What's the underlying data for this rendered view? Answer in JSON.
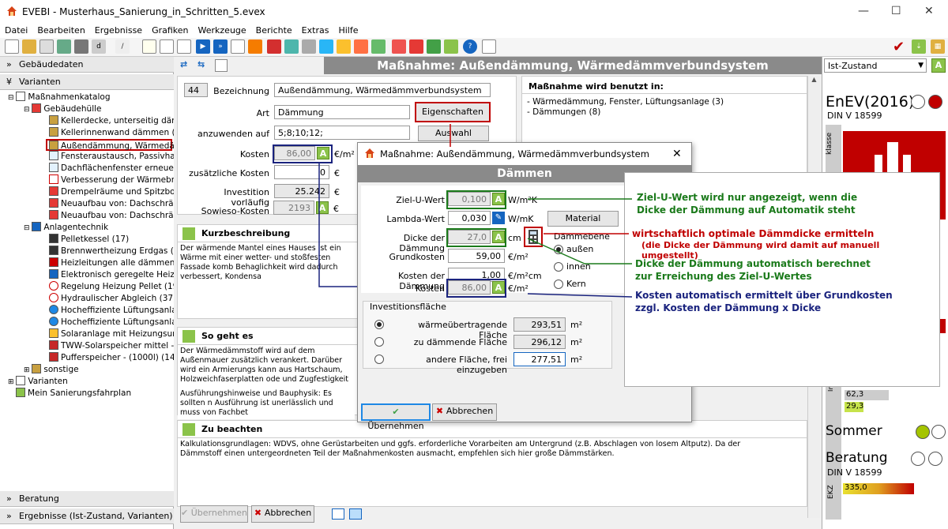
{
  "window": {
    "title": "EVEBI - Musterhaus_Sanierung_in_Schritten_5.evex"
  },
  "menu": [
    "Datei",
    "Bearbeiten",
    "Ergebnisse",
    "Grafiken",
    "Werkzeuge",
    "Berichte",
    "Extras",
    "Hilfe"
  ],
  "left": {
    "sections": {
      "gebaeudedaten": "Gebäudedaten",
      "varianten": "Varianten",
      "beratung": "Beratung",
      "ergebnisse": "Ergebnisse (Ist-Zustand, Varianten)"
    },
    "tree": {
      "root": "Maßnahmenkatalog",
      "gebaeudehuelle": "Gebäudehülle",
      "huelle_items": [
        "Kellerdecke, unterseitig dämme",
        "Kellerinnenwand dämmen (7)",
        "Außendämmung, Wärmedämm",
        "Fensteraustausch, Passivhaus",
        "Dachflächenfenster erneuern",
        "Verbesserung der Wärmebrück",
        "Drempelräume und Spitzboden",
        "Neuaufbau von: Dachschräge",
        "Neuaufbau von: Dachschräge"
      ],
      "anlagentechnik": "Anlagentechnik",
      "anlagen_items": [
        "Pelletkessel (17)",
        "Brennwertheizung Erdgas (41)",
        "Heizleitungen alle dämmen (11",
        "Elektronisch geregelte Heizung",
        "Regelung Heizung Pellet (19)",
        "Hydraulischer Abgleich (37)",
        "Hocheffiziente Lüftungsanlage",
        "Hocheffiziente Lüftungsanlage",
        "Solaranlage mit Heizungsunters",
        "TWW-Solarspeicher mittel - (50",
        "Pufferspeicher - (1000l) (14)"
      ],
      "sonstige": "sonstige",
      "varianten": "Varianten",
      "fahrplan": "Mein Sanierungsfahrplan"
    }
  },
  "main": {
    "title": "Maßnahme: Außendämmung, Wärmedämmverbundsystem",
    "form": {
      "id": "44",
      "bezeichnung_label": "Bezeichnung",
      "bezeichnung": "Außendämmung, Wärmedämmverbundsystem",
      "art_label": "Art",
      "art": "Dämmung",
      "anwenden_label": "anzuwenden auf",
      "anwenden": "5;8;10;12;",
      "kosten_label": "Kosten",
      "kosten": "86,00",
      "kosten_unit": "€/m²",
      "zusatz_label": "zusätzliche Kosten",
      "zusatz": "0",
      "zusatz_unit": "€",
      "invest_label": "Investition vorläufig",
      "invest": "25.242",
      "invest_unit": "€",
      "sowieso_label": "Sowieso-Kosten",
      "sowieso": "2193",
      "sowieso_unit": "€",
      "eigenschaften": "Eigenschaften",
      "auswahl": "Auswahl"
    },
    "used": {
      "title": "Maßnahme wird benutzt in:",
      "items": [
        "- Wärmedämmung, Fenster, Lüftungsanlage (3)",
        "- Dämmungen (8)"
      ]
    },
    "kurz": {
      "title": "Kurzbeschreibung",
      "text": "Der wärmende Mantel eines Hauses ist ein Wärme mit einer wetter- und stoßfesten Fassade komb Behaglichkeit wird dadurch verbessert, Kondensa"
    },
    "sogehts": {
      "title": "So geht es",
      "text": "Der Wärmedämmstoff wird auf dem Außenmauer zusätzlich verankert. Darüber wird ein Armierungs kann aus Hartschaum, Holzweichfaserplatten ode und Zugfestigkeit sowie dem Brandverhalten genü",
      "text2": "Ausführungshinweise und Bauphysik: Es sollten n Ausführung ist unerlässlich und muss von Fachbet"
    },
    "beachten": {
      "title": "Zu beachten",
      "text": "Kalkulationsgrundlagen: WDVS, ohne Gerüstarbeiten und ggfs. erforderliche Vorarbeiten am Untergrund (z.B. Abschlagen von losem Altputz). Da der Dämmstoff einen untergeordneten Teil der Maßnahmenkosten ausmacht, empfehlen sich hier große Dämmstärken."
    },
    "footer": {
      "uebernehmen": "Übernehmen",
      "abbrechen": "Abbrechen"
    }
  },
  "dialog": {
    "title": "Maßnahme: Außendämmung, Wärmedämmverbundsystem",
    "head": "Dämmen",
    "ziel_label": "Ziel-U-Wert",
    "ziel": "0,100",
    "ziel_unit": "W/m²K",
    "lambda_label": "Lambda-Wert",
    "lambda": "0,030",
    "lambda_unit": "W/mK",
    "material": "Material",
    "dicke_label": "Dicke der Dämmung",
    "dicke": "27,0",
    "dicke_unit": "cm",
    "grund_label": "Grundkosten",
    "grund": "59,00",
    "grund_unit": "€/m²",
    "kd_label": "Kosten der Dämmung",
    "kd": "1,00",
    "kd_unit": "€/m²cm",
    "kosten_label": "Kosten",
    "kosten": "86,00",
    "kosten_unit": "€/m²",
    "ebene": {
      "title": "Dämmebene",
      "opts": [
        "außen",
        "innen",
        "Kern"
      ],
      "selected": 0
    },
    "invest": {
      "title": "Investitionsfläche",
      "rows": [
        {
          "label": "wärmeübertragende Fläche",
          "val": "293,51",
          "unit": "m²"
        },
        {
          "label": "zu dämmende Fläche",
          "val": "296,12",
          "unit": "m²"
        },
        {
          "label": "andere Fläche, frei einzugeben",
          "val": "277,51",
          "unit": "m²"
        }
      ],
      "selected": 0
    },
    "ok": "Übernehmen",
    "cancel": "Abbrechen"
  },
  "annotations": {
    "a1": "Ziel-U-Wert wird nur angezeigt, wenn die Dicke der Dämmung auf Automatik steht",
    "a2": "wirtschaftlich optimale Dämmdicke ermitteln",
    "a2b": "(die Dicke der Dämmung wird damit auf manuell umgestellt)",
    "a3": "Dicke der Dämmung automatisch berechnet zur Erreichung des Ziel-U-Wertes",
    "a4": "Kosten automatisch ermittelt über Grundkosten zzgl. Kosten der Dämmung x Dicke"
  },
  "right": {
    "zustand": "Ist-Zustand",
    "enev": "EnEV(2016)",
    "din1": "DIN V 18599",
    "klasse": "klasse",
    "v1": "62,3",
    "v2": "29,3",
    "infmin": "Inf min",
    "sommer": "Sommer",
    "beratung": "Beratung",
    "din2": "DIN V 18599",
    "ekz": "EKZ",
    "ekzval": "335,0"
  },
  "colors": {
    "accent_green": "#8bc34a",
    "red": "#c00000",
    "navy": "#1a237e",
    "green_text": "#1b7a1b"
  }
}
